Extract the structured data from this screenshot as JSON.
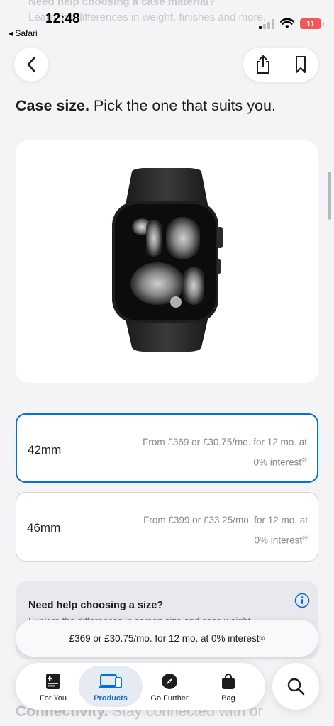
{
  "status_bar": {
    "time": "12:48",
    "back_app": "Safari",
    "battery": "11",
    "battery_color": "#f1585a"
  },
  "background_top": {
    "heading": "Need help choosing a case material?",
    "body": "Learn the differences in weight, finishes and more."
  },
  "nav": {
    "back_icon": "chevron-left-icon",
    "share_icon": "share-icon",
    "bookmark_icon": "bookmark-icon"
  },
  "headline": {
    "bold": "Case size.",
    "rest": "Pick the one that suits you."
  },
  "product_image": {
    "icon": "apple-watch-image"
  },
  "options": [
    {
      "size": "42mm",
      "price_line1": "From £369 or £30.75/mo. for 12 mo. at",
      "price_line2": "0% interest",
      "footnote": "◊◊",
      "selected": true
    },
    {
      "size": "46mm",
      "price_line1": "From £399 or £33.25/mo. for 12 mo. at",
      "price_line2": "0% interest",
      "footnote": "◊◊",
      "selected": false
    }
  ],
  "help": {
    "title": "Need help choosing a size?",
    "body": "Explore the differences in screen size and case weight.",
    "icon": "info-icon"
  },
  "price_bar": {
    "text": "£369 or £30.75/mo. for 12 mo. at 0% interest",
    "footnote": "◊◊"
  },
  "tabs": [
    {
      "label": "For You",
      "icon": "for-you-icon",
      "active": false
    },
    {
      "label": "Products",
      "icon": "products-icon",
      "active": true
    },
    {
      "label": "Go Further",
      "icon": "compass-icon",
      "active": false
    },
    {
      "label": "Bag",
      "icon": "bag-icon",
      "active": false
    }
  ],
  "search": {
    "icon": "search-icon"
  },
  "background_bottom": {
    "bold": "Connectivity.",
    "rest": "Stay connected with or"
  },
  "colors": {
    "accent": "#0071e3",
    "background": "#f4f4f6",
    "muted_text": "#86868b"
  }
}
